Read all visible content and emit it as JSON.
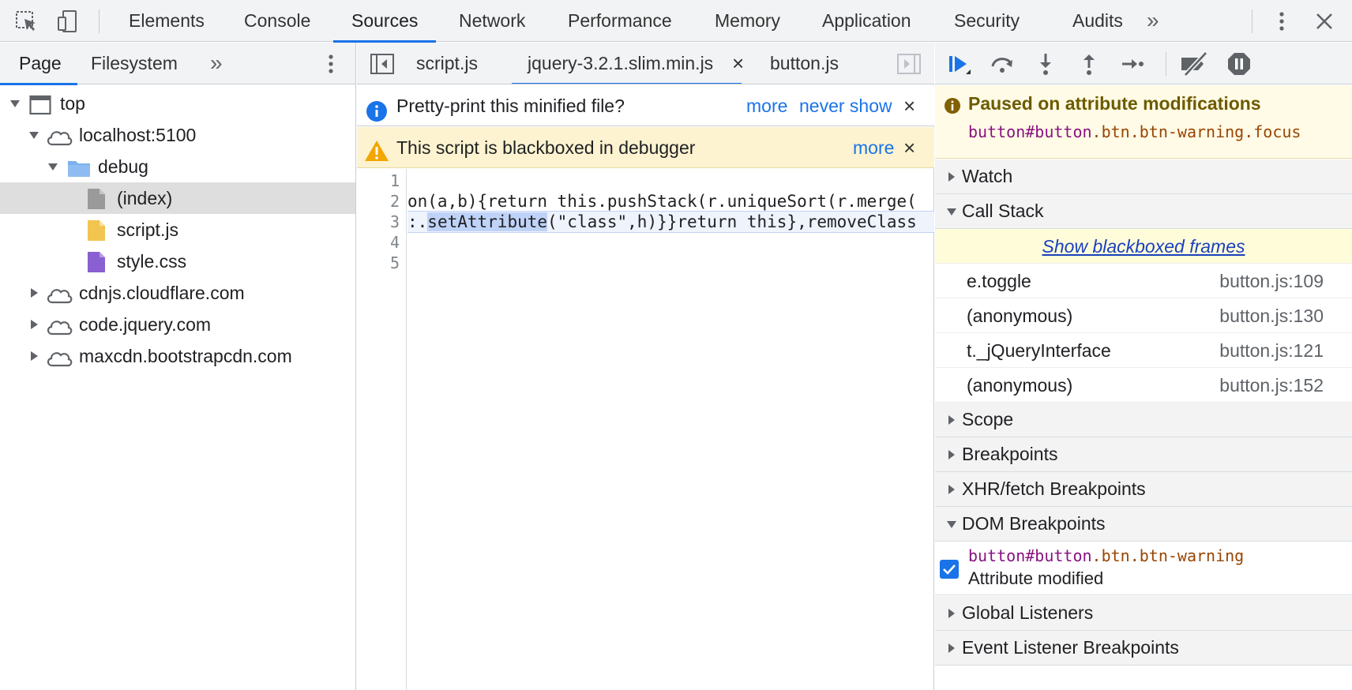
{
  "topbar": {
    "tabs": [
      "Elements",
      "Console",
      "Sources",
      "Network",
      "Performance",
      "Memory",
      "Application",
      "Security",
      "Audits"
    ],
    "active_tab": "Sources",
    "overflow_glyph": "»",
    "icons": [
      "inspect-element-icon",
      "device-toolbar-icon",
      "overflow-tabs-icon",
      "more-options-icon",
      "close-icon"
    ]
  },
  "navigator": {
    "tabs": [
      "Page",
      "Filesystem"
    ],
    "overflow_glyph": "»",
    "tree": [
      {
        "label": "top",
        "type": "frame",
        "expanded": true
      },
      {
        "label": "localhost:5100",
        "type": "domain",
        "expanded": true
      },
      {
        "label": "debug",
        "type": "folder",
        "expanded": true
      },
      {
        "label": "(index)",
        "type": "document",
        "selected": true
      },
      {
        "label": "script.js",
        "type": "script"
      },
      {
        "label": "style.css",
        "type": "stylesheet"
      },
      {
        "label": "cdnjs.cloudflare.com",
        "type": "domain",
        "expanded": false
      },
      {
        "label": "code.jquery.com",
        "type": "domain",
        "expanded": false
      },
      {
        "label": "maxcdn.bootstrapcdn.com",
        "type": "domain",
        "expanded": false
      }
    ]
  },
  "editor": {
    "tabs": [
      "script.js",
      "jquery-3.2.1.slim.min.js",
      "button.js"
    ],
    "active_tab": "jquery-3.2.1.slim.min.js",
    "close_glyph": "×",
    "pretty_print": {
      "text": "Pretty-print this minified file?",
      "more": "more",
      "never_show": "never show"
    },
    "blackbox": {
      "text": "This script is blackboxed in debugger",
      "more": "more"
    },
    "line_numbers": [
      "1",
      "2",
      "3",
      "4",
      "5"
    ],
    "lines": {
      "l2": "on(a,b){return this.pushStack(r.uniqueSort(r.merge(",
      "l3_pre": ":.",
      "l3_hl": "setAttribute",
      "l3_post": "(\"class\",h)}}return this},removeClass"
    }
  },
  "debugger": {
    "paused": {
      "title": "Paused on attribute modifications",
      "tag": "button",
      "id_part": "#button",
      "class_part": ".btn.btn-warning.focus"
    },
    "sections": {
      "watch": "Watch",
      "call_stack": "Call Stack",
      "scope": "Scope",
      "breakpoints": "Breakpoints",
      "xhr": "XHR/fetch Breakpoints",
      "dom": "DOM Breakpoints",
      "global": "Global Listeners",
      "event": "Event Listener Breakpoints"
    },
    "show_blackboxed": "Show blackboxed frames",
    "frames": [
      {
        "fn": "e.toggle",
        "loc": "button.js:109"
      },
      {
        "fn": "(anonymous)",
        "loc": "button.js:130"
      },
      {
        "fn": "t._jQueryInterface",
        "loc": "button.js:121"
      },
      {
        "fn": "(anonymous)",
        "loc": "button.js:152"
      }
    ],
    "dom_breakpoint": {
      "tag": "button",
      "id_part": "#button",
      "class_part": ".btn.btn-warning",
      "type": "Attribute modified",
      "checked": true
    }
  },
  "colors": {
    "accent": "#1a73e8",
    "toolbar": "#f1f3f4",
    "paused_bg": "#fffbe6",
    "warning_bg": "#fdf3d0",
    "blackbox_link_bg": "#fffdd9"
  }
}
